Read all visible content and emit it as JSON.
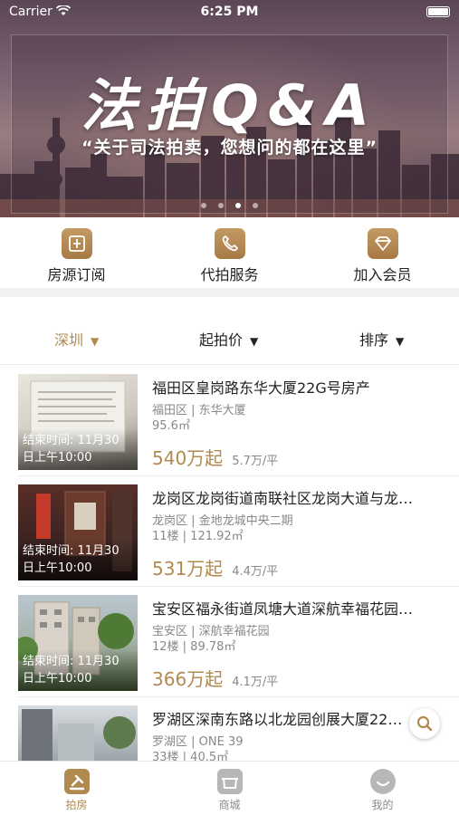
{
  "status_bar": {
    "carrier": "Carrier",
    "time": "6:25 PM"
  },
  "banner": {
    "title": "法拍Q&A",
    "subtitle": "“关于司法拍卖，您想问的都在这里”",
    "dots_total": 4,
    "dots_active": 2
  },
  "quick_actions": [
    {
      "label": "房源订阅",
      "icon": "subscribe-icon"
    },
    {
      "label": "代拍服务",
      "icon": "phone-icon"
    },
    {
      "label": "加入会员",
      "icon": "diamond-icon"
    }
  ],
  "filters": {
    "city": "深圳",
    "price": "起拍价",
    "sort": "排序"
  },
  "listings": [
    {
      "title": "福田区皇岗路东华大厦22G号房产",
      "meta1": "福田区 | 东华大厦",
      "meta2": "95.6㎡",
      "price": "540万起",
      "unit_price": "5.7万/平",
      "end_line1": "结束时间: 11月30",
      "end_line2": "日上午10:00"
    },
    {
      "title": "龙岗区龙岗街道南联社区龙岗大道与龙…",
      "meta1": "龙岗区 | 金地龙城中央二期",
      "meta2": "11楼 | 121.92㎡",
      "price": "531万起",
      "unit_price": "4.4万/平",
      "end_line1": "结束时间: 11月30",
      "end_line2": "日上午10:00"
    },
    {
      "title": "宝安区福永街道凤塘大道深航幸福花园…",
      "meta1": "宝安区 | 深航幸福花园",
      "meta2": "12楼 | 89.78㎡",
      "price": "366万起",
      "unit_price": "4.1万/平",
      "end_line1": "结束时间: 11月30",
      "end_line2": "日上午10:00"
    },
    {
      "title": "罗湖区深南东路以北龙园创展大厦22…",
      "meta1": "罗湖区 | ONE 39",
      "meta2": "33楼 | 40.5㎡",
      "price": "",
      "unit_price": "",
      "end_line1": "",
      "end_line2": ""
    }
  ],
  "tabbar": [
    {
      "label": "拍房",
      "icon": "auction-icon",
      "active": true
    },
    {
      "label": "商城",
      "icon": "shop-icon",
      "active": false
    },
    {
      "label": "我的",
      "icon": "profile-icon",
      "active": false
    }
  ],
  "colors": {
    "accent": "#b08a4f",
    "muted": "#888888"
  }
}
